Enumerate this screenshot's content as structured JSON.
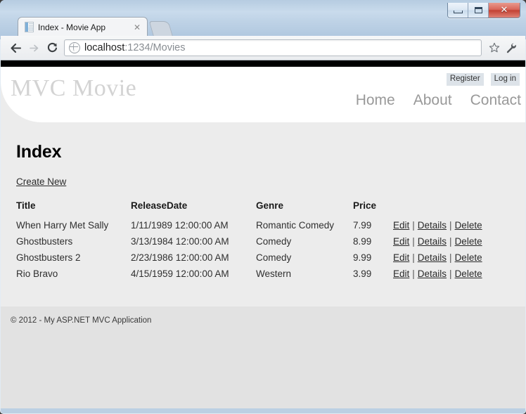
{
  "window": {
    "controls": {
      "minimize_label": "Minimize",
      "maximize_label": "Maximize",
      "close_label": "✕"
    }
  },
  "browser": {
    "tab": {
      "title": "Index - Movie App",
      "close_label": "✕",
      "favicon": "page-icon"
    },
    "new_tab_label": "New Tab",
    "toolbar": {
      "back_label": "Back",
      "forward_label": "Forward",
      "reload_label": "Reload",
      "bookmark_label": "Bookmark this page",
      "menu_label": "Customize and control",
      "url_host": "localhost",
      "url_rest": ":1234/Movies"
    }
  },
  "page": {
    "brand": "MVC Movie",
    "auth": [
      {
        "label": "Register"
      },
      {
        "label": "Log in"
      }
    ],
    "nav": [
      {
        "label": "Home"
      },
      {
        "label": "About"
      },
      {
        "label": "Contact"
      }
    ],
    "title": "Index",
    "create_new_label": "Create New",
    "table": {
      "headers": [
        "Title",
        "ReleaseDate",
        "Genre",
        "Price",
        ""
      ],
      "rows": [
        {
          "title": "When Harry Met Sally",
          "release_date": "1/11/1989 12:00:00 AM",
          "genre": "Romantic Comedy",
          "price": "7.99",
          "actions": [
            "Edit",
            "Details",
            "Delete"
          ]
        },
        {
          "title": "Ghostbusters",
          "release_date": "3/13/1984 12:00:00 AM",
          "genre": "Comedy",
          "price": "8.99",
          "actions": [
            "Edit",
            "Details",
            "Delete"
          ]
        },
        {
          "title": "Ghostbusters 2",
          "release_date": "2/23/1986 12:00:00 AM",
          "genre": "Comedy",
          "price": "9.99",
          "actions": [
            "Edit",
            "Details",
            "Delete"
          ]
        },
        {
          "title": "Rio Bravo",
          "release_date": "4/15/1959 12:00:00 AM",
          "genre": "Western",
          "price": "3.99",
          "actions": [
            "Edit",
            "Details",
            "Delete"
          ]
        }
      ],
      "action_separator": "|"
    },
    "footer": "© 2012 - My ASP.NET MVC Application"
  },
  "colors": {
    "accent_black": "#000000",
    "brand_gray": "#d3d3d3",
    "body_gray": "#ececec",
    "footer_gray": "#e2e2e2"
  }
}
